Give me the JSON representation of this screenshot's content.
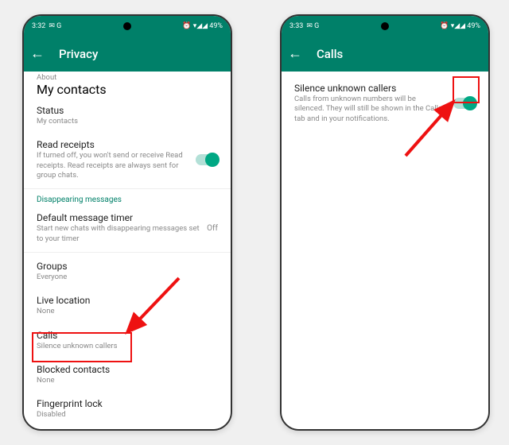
{
  "phone_left": {
    "status": {
      "time": "3:32",
      "icons_left": "✉ G",
      "icons_right": "⏰ ▾◢◢ 49%"
    },
    "appbar": {
      "title": "Privacy"
    },
    "rows": {
      "about": {
        "label": "About",
        "sub": "My contacts"
      },
      "status": {
        "label": "Status",
        "sub": "My contacts"
      },
      "read_receipts": {
        "label": "Read receipts",
        "sub": "If turned off, you won't send or receive Read receipts. Read receipts are always sent for group chats."
      },
      "section_disappearing": "Disappearing messages",
      "default_timer": {
        "label": "Default message timer",
        "sub": "Start new chats with disappearing messages set to your timer",
        "value": "Off"
      },
      "groups": {
        "label": "Groups",
        "sub": "Everyone"
      },
      "live_location": {
        "label": "Live location",
        "sub": "None"
      },
      "calls": {
        "label": "Calls",
        "sub": "Silence unknown callers"
      },
      "blocked": {
        "label": "Blocked contacts",
        "sub": "None"
      },
      "fingerprint": {
        "label": "Fingerprint lock",
        "sub": "Disabled"
      }
    }
  },
  "phone_right": {
    "status": {
      "time": "3:33",
      "icons_left": "✉ G",
      "icons_right": "⏰ ▾◢◢ 49%"
    },
    "appbar": {
      "title": "Calls"
    },
    "silence": {
      "label": "Silence unknown callers",
      "sub": "Calls from unknown numbers will be silenced. They will still be shown in the Calls tab and in your notifications."
    }
  }
}
